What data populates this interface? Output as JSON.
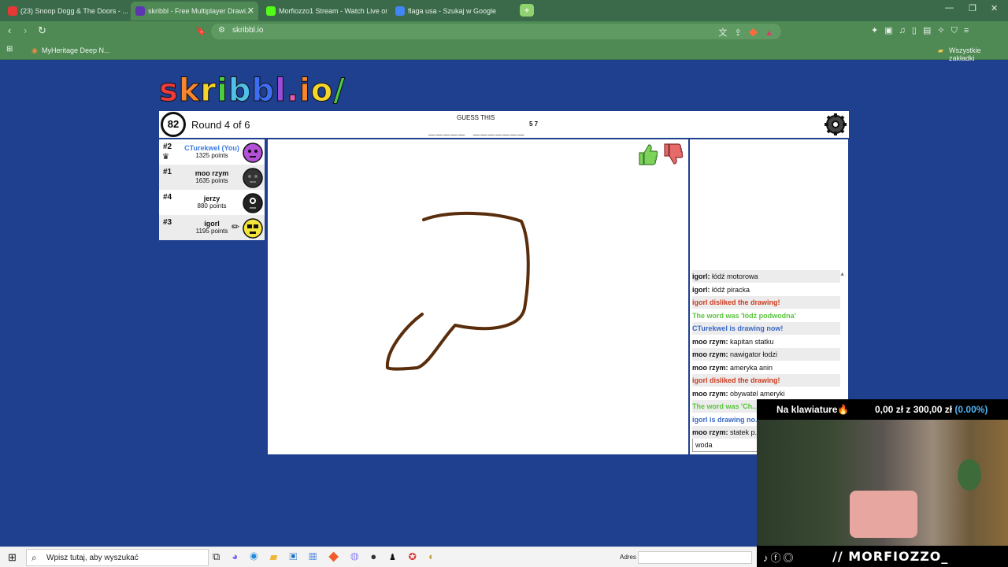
{
  "browser": {
    "tabs": [
      {
        "label": "(23) Snoop Dogg & The Doors - ...",
        "color": "#e53935"
      },
      {
        "label": "skribbl - Free Multiplayer Drawi...",
        "color": "#5e35b1"
      },
      {
        "label": "Morfiozzo1 Stream - Watch Live on K...",
        "color": "#53fc18"
      },
      {
        "label": "flaga usa - Szukaj w Google",
        "color": "#4285f4"
      }
    ],
    "url": "skribbl.io",
    "bookmarks": {
      "left": "MyHeritage Deep N...",
      "right": "Wszystkie zakładki"
    }
  },
  "game": {
    "logo_letters": [
      "s",
      "k",
      "r",
      "i",
      "b",
      "b",
      "l",
      ".",
      "i",
      "o",
      "/"
    ],
    "timer": "82",
    "round": "Round 4 of 6",
    "guess_title": "GUESS THIS",
    "hint": "_____ _______",
    "hint_count": "5 7",
    "players": [
      {
        "rank": "#2",
        "name": "CTurekwel (You)",
        "points": "1325 points",
        "you": true,
        "avatar_color": "#b44fd8"
      },
      {
        "rank": "#1",
        "name": "moo rzym",
        "points": "1635 points",
        "you": false,
        "avatar_color": "#333333"
      },
      {
        "rank": "#4",
        "name": "jerzy",
        "points": "880 points",
        "you": false,
        "avatar_color": "#222222"
      },
      {
        "rank": "#3",
        "name": "igorl",
        "points": "1195 points",
        "you": false,
        "avatar_color": "#f2e43a"
      }
    ],
    "drawing_color": "#5a2d0c",
    "chat": [
      {
        "user": "igorl:",
        "text": " łódź motorowa",
        "style": "normal"
      },
      {
        "user": "igorl:",
        "text": " łódź piracka",
        "style": "normal"
      },
      {
        "user": "",
        "text": "igorl disliked the drawing!",
        "style": "red"
      },
      {
        "user": "",
        "text": "The word was 'łódź podwodna'",
        "style": "green"
      },
      {
        "user": "",
        "text": "CTurekwel is drawing now!",
        "style": "blue"
      },
      {
        "user": "moo rzym:",
        "text": " kapitan statku",
        "style": "normal"
      },
      {
        "user": "moo rzym:",
        "text": " nawigator łodzi",
        "style": "normal"
      },
      {
        "user": "moo rzym:",
        "text": " ameryka anin",
        "style": "normal"
      },
      {
        "user": "",
        "text": "igorl disliked the drawing!",
        "style": "red"
      },
      {
        "user": "moo rzym:",
        "text": " obywatel ameryki",
        "style": "normal"
      },
      {
        "user": "",
        "text": "The word was 'Ch...",
        "style": "green"
      },
      {
        "user": "",
        "text": "igorl is drawing no...",
        "style": "blue"
      },
      {
        "user": "moo rzym:",
        "text": " statek p...",
        "style": "normal"
      }
    ],
    "chat_input_value": "woda"
  },
  "overlay": {
    "label": "Na klawiature🔥",
    "money_main": "0,00 zł z 300,00 zł ",
    "money_pct": "(0.00%)",
    "handle": "// MORFIOZZO_"
  },
  "taskbar": {
    "search_placeholder": "Wpisz tutaj, aby wyszukać",
    "adres_label": "Adres"
  }
}
